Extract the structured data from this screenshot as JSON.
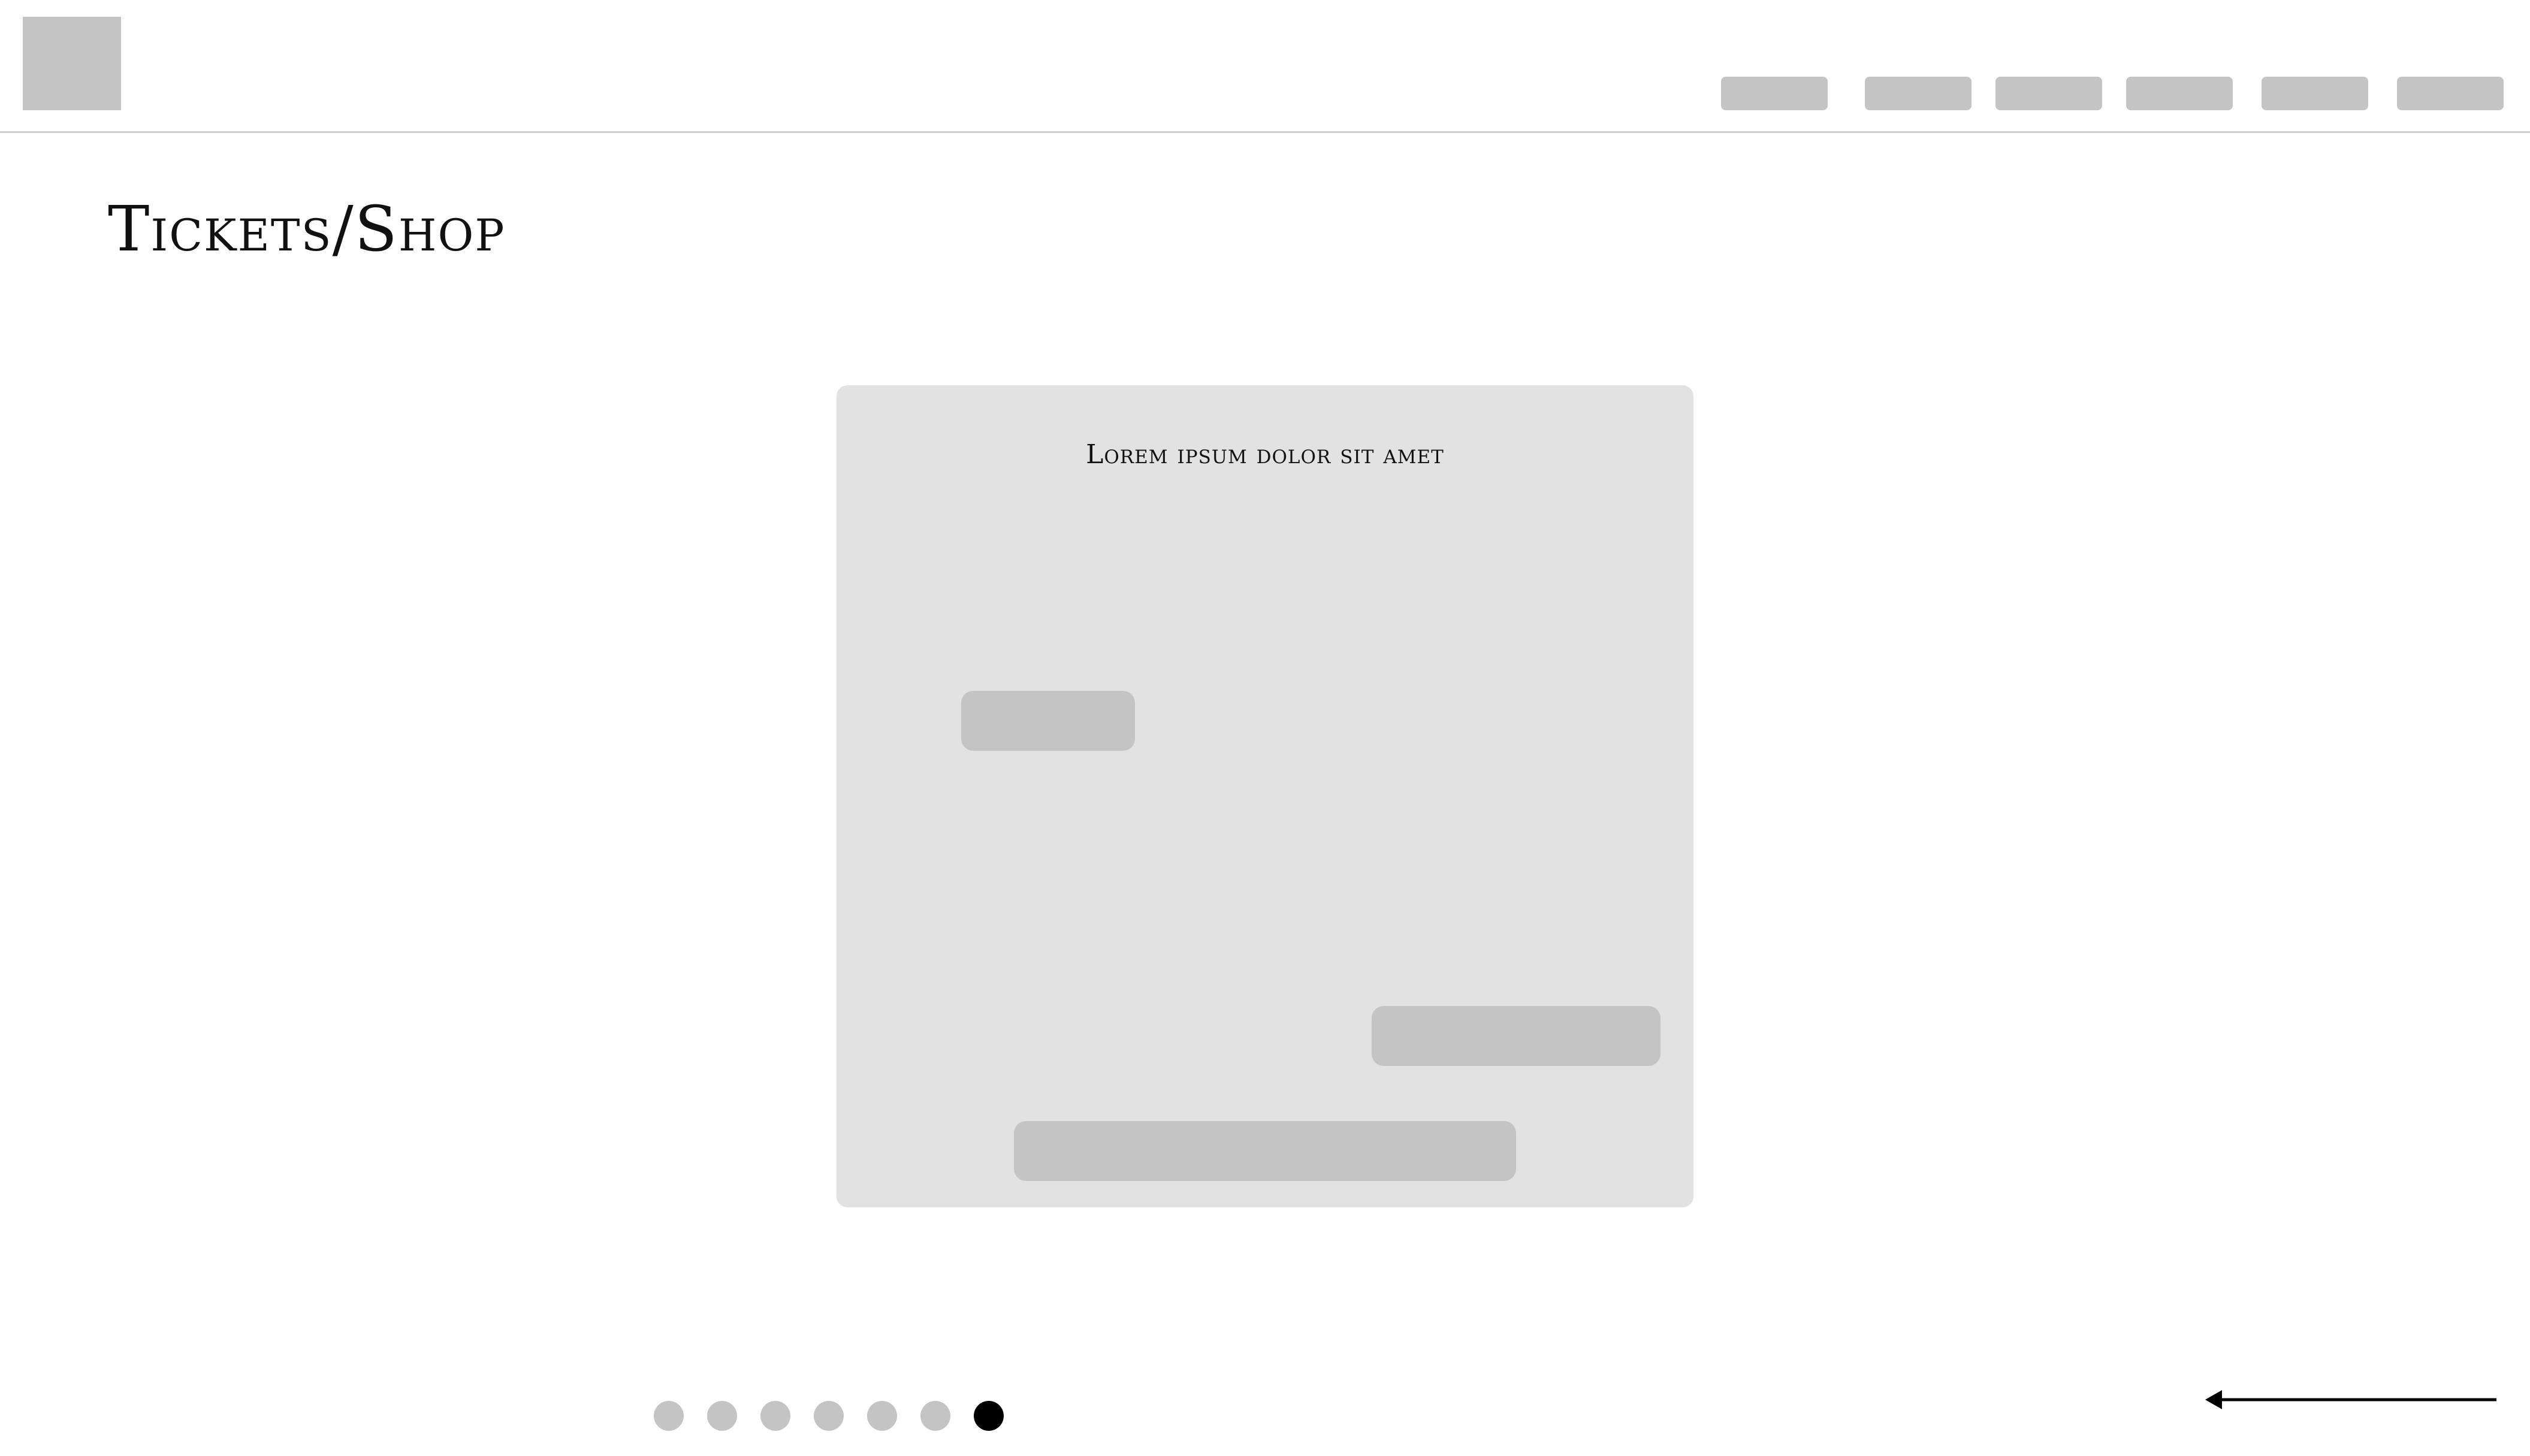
{
  "header": {
    "nav_items": [
      "",
      "",
      "",
      "",
      "",
      ""
    ]
  },
  "page": {
    "title": "Tickets/Shop"
  },
  "card": {
    "heading": "Lorem ipsum dolor sit amet"
  },
  "pagination": {
    "count": 7,
    "active_index": 6
  },
  "icons": {
    "arrow": "arrow-left-icon"
  },
  "colors": {
    "placeholder": "#c4c4c4",
    "card_background": "#e2e2e2",
    "active_dot": "#000000",
    "divider": "#cfcfcf"
  }
}
